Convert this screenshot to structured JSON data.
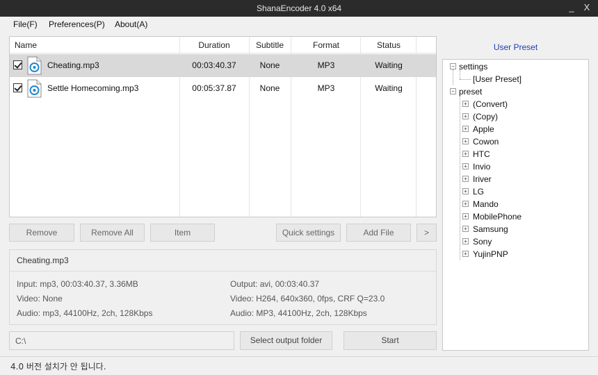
{
  "window": {
    "title": "ShanaEncoder 4.0 x64",
    "minimize_glyph": "_",
    "close_glyph": "X"
  },
  "menu": [
    "File(F)",
    "Preferences(P)",
    "About(A)"
  ],
  "table": {
    "columns": [
      "Name",
      "Duration",
      "Subtitle",
      "Format",
      "Status"
    ],
    "rows": [
      {
        "checked": true,
        "name": "Cheating.mp3",
        "duration": "00:03:40.37",
        "subtitle": "None",
        "format": "MP3",
        "status": "Waiting",
        "selected": true
      },
      {
        "checked": true,
        "name": "Settle Homecoming.mp3",
        "duration": "00:05:37.87",
        "subtitle": "None",
        "format": "MP3",
        "status": "Waiting",
        "selected": false
      }
    ]
  },
  "buttons": {
    "remove": "Remove",
    "remove_all": "Remove All",
    "item": "Item",
    "quick_settings": "Quick settings",
    "add_file": "Add File",
    "more": ">",
    "select_output": "Select output folder",
    "start": "Start"
  },
  "info": {
    "filename": "Cheating.mp3",
    "input": "Input: mp3, 00:03:40.37, 3.36MB",
    "video_in": "Video: None",
    "audio_in": "Audio: mp3, 44100Hz, 2ch, 128Kbps",
    "output": "Output: avi, 00:03:40.37",
    "video_out": "Video: H264, 640x360, 0fps, CRF Q=23.0",
    "audio_out": "Audio: MP3, 44100Hz, 2ch, 128Kbps"
  },
  "output_path": "C:\\",
  "preset": {
    "title": "User Preset",
    "settings_label": "settings",
    "settings_child": "[User Preset]",
    "preset_label": "preset",
    "preset_children": [
      "(Convert)",
      "(Copy)",
      "Apple",
      "Cowon",
      "HTC",
      "Invio",
      "Iriver",
      "LG",
      "Mando",
      "MobilePhone",
      "Samsung",
      "Sony",
      "YujinPNP"
    ]
  },
  "status_message": "4.0 버전 설치가 안 됩니다.",
  "colors": {
    "accent": "#1a3fb5",
    "titlebar": "#2b2b2b",
    "selected_row": "#d9d9d9"
  },
  "icons": {
    "file": "audio-file-icon",
    "expand": "plus-expander-icon",
    "collapse": "minus-expander-icon",
    "checkbox": "checkbox-checked-icon"
  }
}
